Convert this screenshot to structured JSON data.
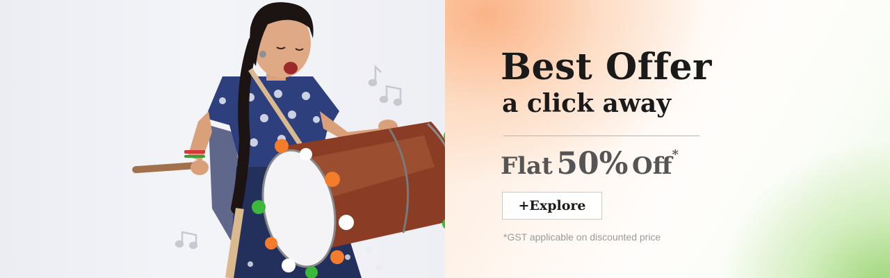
{
  "offer": {
    "title_line1": "Best Offer",
    "title_line2": "a click away",
    "discount_prefix": "Flat",
    "discount_value": "50%",
    "discount_suffix": "Off",
    "discount_asterisk": "*",
    "explore_label": "+Explore",
    "gst_note": "*GST applicable on discounted price"
  },
  "colors": {
    "saffron": "#f7a26b",
    "green": "#8fce5c",
    "text_dark": "#1a1a1a",
    "text_grey": "#555555",
    "note_grey": "#9a9a9a"
  },
  "photo": {
    "subject": "girl-playing-dhol-drum-image",
    "icons": [
      "music-note-icon",
      "music-note-icon",
      "music-note-icon"
    ]
  }
}
